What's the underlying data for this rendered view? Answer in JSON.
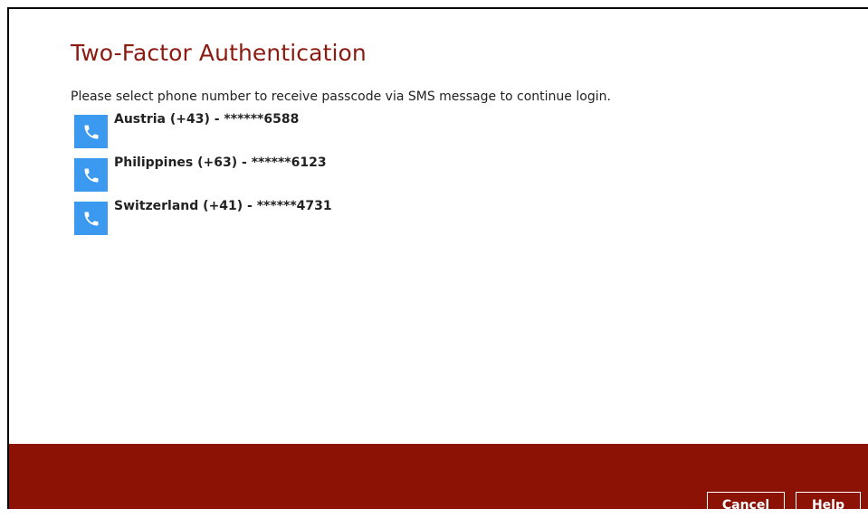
{
  "dialog": {
    "title": "Two-Factor Authentication",
    "instruction": "Please select phone number to receive passcode via SMS message to continue login."
  },
  "phones": [
    {
      "label": "Austria (+43) - ******6588",
      "icon": "phone-icon"
    },
    {
      "label": "Philippines (+63) - ******6123",
      "icon": "phone-icon"
    },
    {
      "label": "Switzerland (+41) - ******4731",
      "icon": "phone-icon"
    }
  ],
  "footer": {
    "cancel_label": "Cancel",
    "help_label": "Help"
  },
  "colors": {
    "title": "#8b1a10",
    "icon_bg": "#3b99f0",
    "footer_bg": "#8b1205"
  }
}
